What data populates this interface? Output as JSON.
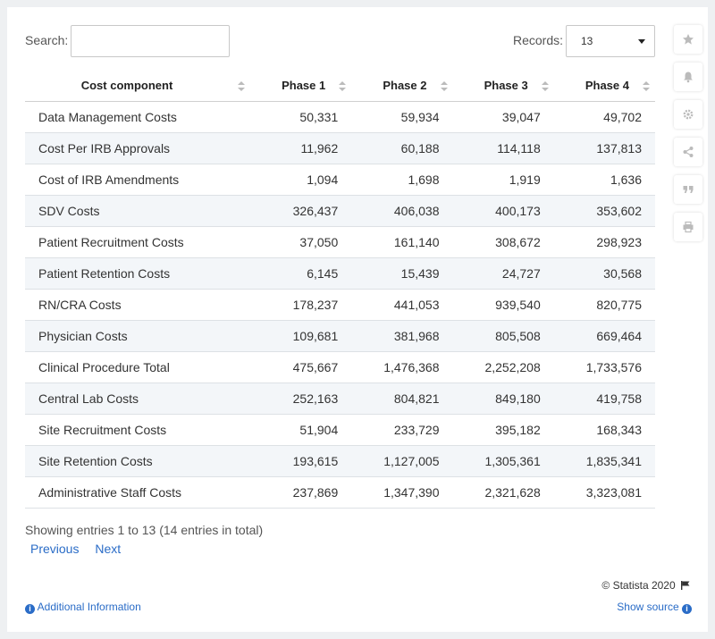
{
  "search": {
    "label": "Search:",
    "value": ""
  },
  "records": {
    "label": "Records:",
    "value": "13"
  },
  "table": {
    "headers": [
      "Cost component",
      "Phase 1",
      "Phase 2",
      "Phase 3",
      "Phase 4"
    ],
    "rows": [
      [
        "Data Management Costs",
        "50,331",
        "59,934",
        "39,047",
        "49,702"
      ],
      [
        "Cost Per IRB Approvals",
        "11,962",
        "60,188",
        "114,118",
        "137,813"
      ],
      [
        "Cost of IRB Amendments",
        "1,094",
        "1,698",
        "1,919",
        "1,636"
      ],
      [
        "SDV Costs",
        "326,437",
        "406,038",
        "400,173",
        "353,602"
      ],
      [
        "Patient Recruitment Costs",
        "37,050",
        "161,140",
        "308,672",
        "298,923"
      ],
      [
        "Patient Retention Costs",
        "6,145",
        "15,439",
        "24,727",
        "30,568"
      ],
      [
        "RN/CRA Costs",
        "178,237",
        "441,053",
        "939,540",
        "820,775"
      ],
      [
        "Physician Costs",
        "109,681",
        "381,968",
        "805,508",
        "669,464"
      ],
      [
        "Clinical Procedure Total",
        "475,667",
        "1,476,368",
        "2,252,208",
        "1,733,576"
      ],
      [
        "Central Lab Costs",
        "252,163",
        "804,821",
        "849,180",
        "419,758"
      ],
      [
        "Site Recruitment Costs",
        "51,904",
        "233,729",
        "395,182",
        "168,343"
      ],
      [
        "Site Retention Costs",
        "193,615",
        "1,127,005",
        "1,305,361",
        "1,835,341"
      ],
      [
        "Administrative Staff Costs",
        "237,869",
        "1,347,390",
        "2,321,628",
        "3,323,081"
      ]
    ]
  },
  "footer": {
    "info": "Showing entries 1 to 13 (14 entries in total)",
    "previous": "Previous",
    "next": "Next",
    "copyright": "© Statista 2020",
    "additional_info": "Additional Information",
    "show_source": "Show source"
  },
  "sidebar": {
    "icons": [
      "star-icon",
      "bell-icon",
      "gear-icon",
      "share-icon",
      "quote-icon",
      "print-icon"
    ]
  },
  "colors": {
    "link": "#2a6cc7",
    "stripe": "#f3f6f9",
    "icon": "#bbbbbb"
  }
}
